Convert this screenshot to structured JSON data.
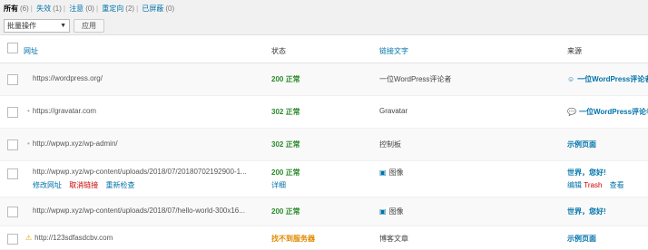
{
  "filters": {
    "all": {
      "label": "所有",
      "count": "(6)"
    },
    "failed": {
      "label": "失效",
      "count": "(1)"
    },
    "notice": {
      "label": "注意",
      "count": "(0)"
    },
    "redirect": {
      "label": "重定向",
      "count": "(2)"
    },
    "hidden": {
      "label": "已屏蔽",
      "count": "(0)"
    },
    "separator": "|"
  },
  "bulk": {
    "select_value": "批量操作",
    "apply": "应用"
  },
  "columns": {
    "url": "网址",
    "status": "状态",
    "link_text": "链接文字",
    "source": "来源"
  },
  "rows": [
    {
      "url": "https://wordpress.org/",
      "status": "200 正常",
      "link_text": "一位WordPress评论者",
      "source": "一位WordPress评论者"
    },
    {
      "url": "https://gravatar.com",
      "status": "302 正常",
      "link_text": "Gravatar",
      "source": "一位WordPress评论者"
    },
    {
      "url": "http://wpwp.xyz/wp-admin/",
      "status": "302 正常",
      "link_text": "控制板",
      "source": "示例页面"
    },
    {
      "url": "http://wpwp.xyz/wp-content/uploads/2018/07/20180702192900-1...",
      "status": "200 正常",
      "status_detail": "详细",
      "link_text": "图像",
      "source": "世界，您好!",
      "actions": [
        "修改网址",
        "取消链接",
        "重新检查"
      ],
      "source_actions": [
        "编辑",
        "Trash",
        "查看"
      ]
    },
    {
      "url": "http://wpwp.xyz/wp-content/uploads/2018/07/hello-world-300x16...",
      "status": "200 正常",
      "link_text": "图像",
      "source": "世界，您好!"
    },
    {
      "url": "http://123sdfasdcbv.com",
      "status": "找不到服务器",
      "link_text": "博客文章",
      "source": "示例页面"
    }
  ],
  "icons": {
    "user": "user-icon",
    "comment": "comment-icon",
    "image": "image-icon",
    "warning": "warning-icon",
    "bullet": "bullet-icon"
  },
  "colors": {
    "link": "#0073aa",
    "ok": "#2a8a2a",
    "error": "#e08a00",
    "danger": "#c00"
  }
}
